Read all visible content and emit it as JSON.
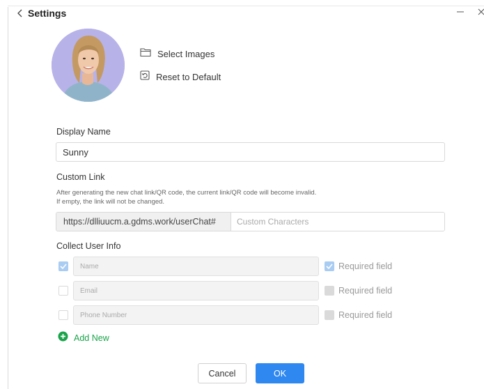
{
  "window": {
    "title": "Settings"
  },
  "avatar": {
    "actions": {
      "select_label": "Select Images",
      "reset_label": "Reset to Default"
    }
  },
  "display_name": {
    "label": "Display Name",
    "value": "Sunny"
  },
  "custom_link": {
    "label": "Custom Link",
    "hint_line1": "After generating the new chat link/QR code, the current link/QR code will become invalid.",
    "hint_line2": "If empty, the link will not be changed.",
    "prefix": "https://dlliuucm.a.gdms.work/userChat#",
    "placeholder": "Custom Characters",
    "value": ""
  },
  "collect_user_info": {
    "label": "Collect User Info",
    "fields": [
      {
        "placeholder": "Name",
        "collected": true,
        "required": true,
        "required_label": "Required field"
      },
      {
        "placeholder": "Email",
        "collected": false,
        "required": false,
        "required_label": "Required field"
      },
      {
        "placeholder": "Phone Number",
        "collected": false,
        "required": false,
        "required_label": "Required field"
      }
    ],
    "add_new_label": "Add New"
  },
  "footer": {
    "cancel_label": "Cancel",
    "ok_label": "OK"
  },
  "colors": {
    "primary": "#2f88f0",
    "success": "#1aa34a",
    "avatar_background": "#b7b2e8"
  },
  "icons": {
    "back": "chevron-left-icon",
    "minimize": "minimize-icon",
    "close": "close-icon",
    "select_images": "folder-icon",
    "reset": "reset-icon",
    "add_new": "plus-circle-icon",
    "check": "check-icon"
  }
}
